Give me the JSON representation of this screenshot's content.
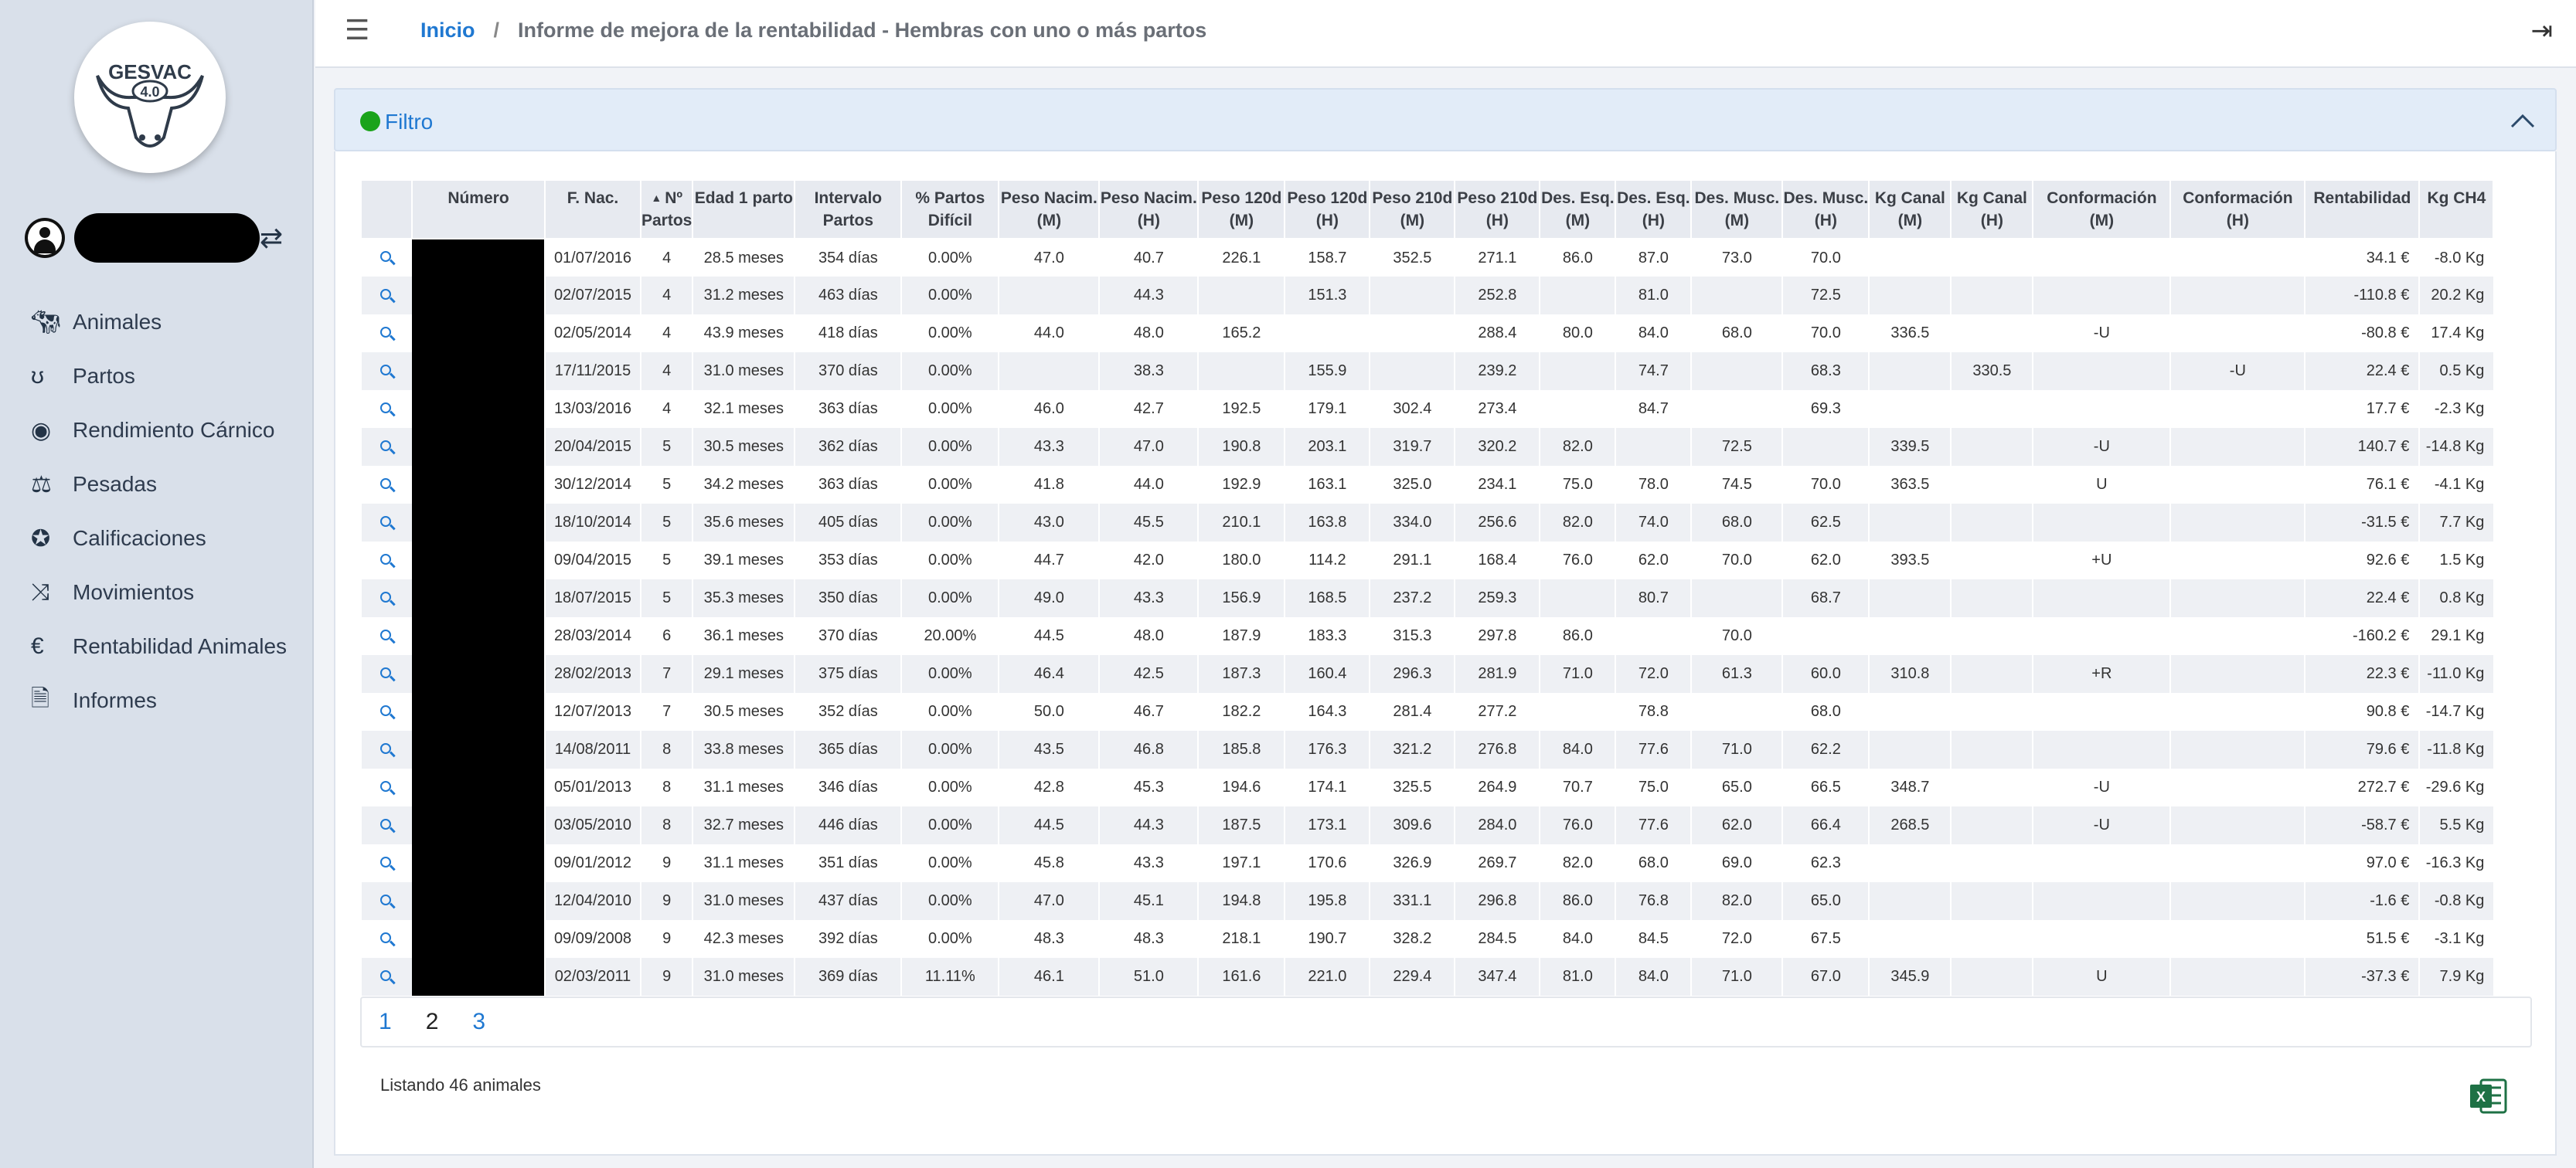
{
  "logo": {
    "text": "GESVAC",
    "version": "4.0"
  },
  "sidebar": {
    "items": [
      {
        "label": "Animales",
        "icon": "cow-icon"
      },
      {
        "label": "Partos",
        "icon": "stethoscope-icon"
      },
      {
        "label": "Rendimiento Cárnico",
        "icon": "gauge-icon"
      },
      {
        "label": "Pesadas",
        "icon": "scale-icon"
      },
      {
        "label": "Calificaciones",
        "icon": "medal-icon"
      },
      {
        "label": "Movimientos",
        "icon": "shuffle-icon"
      },
      {
        "label": "Rentabilidad Animales",
        "icon": "euro-icon"
      },
      {
        "label": "Informes",
        "icon": "report-icon"
      }
    ]
  },
  "header": {
    "home": "Inicio",
    "separator": "/",
    "title": "Informe de mejora de la rentabilidad - Hembras con uno o más partos"
  },
  "filter": {
    "label": "Filtro",
    "status_color": "#1aa31a"
  },
  "table": {
    "columns": [
      "",
      "Número",
      "F. Nac.",
      "Nº Partos",
      "Edad 1 parto",
      "Intervalo Partos",
      "% Partos Difícil",
      "Peso Nacim. (M)",
      "Peso Nacim. (H)",
      "Peso 120d (M)",
      "Peso 120d (H)",
      "Peso 210d (M)",
      "Peso 210d (H)",
      "Des. Esq. (M)",
      "Des. Esq. (H)",
      "Des. Musc. (M)",
      "Des. Musc. (H)",
      "Kg Canal (M)",
      "Kg Canal (H)",
      "Conformación (M)",
      "Conformación (H)",
      "Rentabilidad",
      "Kg CH4"
    ],
    "rows": [
      [
        "01/07/2016",
        "4",
        "28.5 meses",
        "354 días",
        "0.00%",
        "47.0",
        "40.7",
        "226.1",
        "158.7",
        "352.5",
        "271.1",
        "86.0",
        "87.0",
        "73.0",
        "70.0",
        "",
        "",
        "",
        "",
        "34.1 €",
        "-8.0 Kg"
      ],
      [
        "02/07/2015",
        "4",
        "31.2 meses",
        "463 días",
        "0.00%",
        "",
        "44.3",
        "",
        "151.3",
        "",
        "252.8",
        "",
        "81.0",
        "",
        "72.5",
        "",
        "",
        "",
        "",
        "-110.8 €",
        "20.2 Kg"
      ],
      [
        "02/05/2014",
        "4",
        "43.9 meses",
        "418 días",
        "0.00%",
        "44.0",
        "48.0",
        "165.2",
        "",
        "",
        "288.4",
        "80.0",
        "84.0",
        "68.0",
        "70.0",
        "336.5",
        "",
        "-U",
        "",
        "-80.8 €",
        "17.4 Kg"
      ],
      [
        "17/11/2015",
        "4",
        "31.0 meses",
        "370 días",
        "0.00%",
        "",
        "38.3",
        "",
        "155.9",
        "",
        "239.2",
        "",
        "74.7",
        "",
        "68.3",
        "",
        "330.5",
        "",
        "-U",
        "22.4 €",
        "0.5 Kg"
      ],
      [
        "13/03/2016",
        "4",
        "32.1 meses",
        "363 días",
        "0.00%",
        "46.0",
        "42.7",
        "192.5",
        "179.1",
        "302.4",
        "273.4",
        "",
        "84.7",
        "",
        "69.3",
        "",
        "",
        "",
        "",
        "17.7 €",
        "-2.3 Kg"
      ],
      [
        "20/04/2015",
        "5",
        "30.5 meses",
        "362 días",
        "0.00%",
        "43.3",
        "47.0",
        "190.8",
        "203.1",
        "319.7",
        "320.2",
        "82.0",
        "",
        "72.5",
        "",
        "339.5",
        "",
        "-U",
        "",
        "140.7 €",
        "-14.8 Kg"
      ],
      [
        "30/12/2014",
        "5",
        "34.2 meses",
        "363 días",
        "0.00%",
        "41.8",
        "44.0",
        "192.9",
        "163.1",
        "325.0",
        "234.1",
        "75.0",
        "78.0",
        "74.5",
        "70.0",
        "363.5",
        "",
        "U",
        "",
        "76.1 €",
        "-4.1 Kg"
      ],
      [
        "18/10/2014",
        "5",
        "35.6 meses",
        "405 días",
        "0.00%",
        "43.0",
        "45.5",
        "210.1",
        "163.8",
        "334.0",
        "256.6",
        "82.0",
        "74.0",
        "68.0",
        "62.5",
        "",
        "",
        "",
        "",
        "-31.5 €",
        "7.7 Kg"
      ],
      [
        "09/04/2015",
        "5",
        "39.1 meses",
        "353 días",
        "0.00%",
        "44.7",
        "42.0",
        "180.0",
        "114.2",
        "291.1",
        "168.4",
        "76.0",
        "62.0",
        "70.0",
        "62.0",
        "393.5",
        "",
        "+U",
        "",
        "92.6 €",
        "1.5 Kg"
      ],
      [
        "18/07/2015",
        "5",
        "35.3 meses",
        "350 días",
        "0.00%",
        "49.0",
        "43.3",
        "156.9",
        "168.5",
        "237.2",
        "259.3",
        "",
        "80.7",
        "",
        "68.7",
        "",
        "",
        "",
        "",
        "22.4 €",
        "0.8 Kg"
      ],
      [
        "28/03/2014",
        "6",
        "36.1 meses",
        "370 días",
        "20.00%",
        "44.5",
        "48.0",
        "187.9",
        "183.3",
        "315.3",
        "297.8",
        "86.0",
        "",
        "70.0",
        "",
        "",
        "",
        "",
        "",
        "-160.2 €",
        "29.1 Kg"
      ],
      [
        "28/02/2013",
        "7",
        "29.1 meses",
        "375 días",
        "0.00%",
        "46.4",
        "42.5",
        "187.3",
        "160.4",
        "296.3",
        "281.9",
        "71.0",
        "72.0",
        "61.3",
        "60.0",
        "310.8",
        "",
        "+R",
        "",
        "22.3 €",
        "-11.0 Kg"
      ],
      [
        "12/07/2013",
        "7",
        "30.5 meses",
        "352 días",
        "0.00%",
        "50.0",
        "46.7",
        "182.2",
        "164.3",
        "281.4",
        "277.2",
        "",
        "78.8",
        "",
        "68.0",
        "",
        "",
        "",
        "",
        "90.8 €",
        "-14.7 Kg"
      ],
      [
        "14/08/2011",
        "8",
        "33.8 meses",
        "365 días",
        "0.00%",
        "43.5",
        "46.8",
        "185.8",
        "176.3",
        "321.2",
        "276.8",
        "84.0",
        "77.6",
        "71.0",
        "62.2",
        "",
        "",
        "",
        "",
        "79.6 €",
        "-11.8 Kg"
      ],
      [
        "05/01/2013",
        "8",
        "31.1 meses",
        "346 días",
        "0.00%",
        "42.8",
        "45.3",
        "194.6",
        "174.1",
        "325.5",
        "264.9",
        "70.7",
        "75.0",
        "65.0",
        "66.5",
        "348.7",
        "",
        "-U",
        "",
        "272.7 €",
        "-29.6 Kg"
      ],
      [
        "03/05/2010",
        "8",
        "32.7 meses",
        "446 días",
        "0.00%",
        "44.5",
        "44.3",
        "187.5",
        "173.1",
        "309.6",
        "284.0",
        "76.0",
        "77.6",
        "62.0",
        "66.4",
        "268.5",
        "",
        "-U",
        "",
        "-58.7 €",
        "5.5 Kg"
      ],
      [
        "09/01/2012",
        "9",
        "31.1 meses",
        "351 días",
        "0.00%",
        "45.8",
        "43.3",
        "197.1",
        "170.6",
        "326.9",
        "269.7",
        "82.0",
        "68.0",
        "69.0",
        "62.3",
        "",
        "",
        "",
        "",
        "97.0 €",
        "-16.3 Kg"
      ],
      [
        "12/04/2010",
        "9",
        "31.0 meses",
        "437 días",
        "0.00%",
        "47.0",
        "45.1",
        "194.8",
        "195.8",
        "331.1",
        "296.8",
        "86.0",
        "76.8",
        "82.0",
        "65.0",
        "",
        "",
        "",
        "",
        "-1.6 €",
        "-0.8 Kg"
      ],
      [
        "09/09/2008",
        "9",
        "42.3 meses",
        "392 días",
        "0.00%",
        "48.3",
        "48.3",
        "218.1",
        "190.7",
        "328.2",
        "284.5",
        "84.0",
        "84.5",
        "72.0",
        "67.5",
        "",
        "",
        "",
        "",
        "51.5 €",
        "-3.1 Kg"
      ],
      [
        "02/03/2011",
        "9",
        "31.0 meses",
        "369 días",
        "11.11%",
        "46.1",
        "51.0",
        "161.6",
        "221.0",
        "229.4",
        "347.4",
        "81.0",
        "84.0",
        "71.0",
        "67.0",
        "345.9",
        "",
        "U",
        "",
        "-37.3 €",
        "7.9 Kg"
      ]
    ]
  },
  "pagination": {
    "pages": [
      "1",
      "2",
      "3"
    ],
    "active": "2"
  },
  "footer": {
    "listing": "Listando 46 animales",
    "export_icon": "excel-icon"
  }
}
